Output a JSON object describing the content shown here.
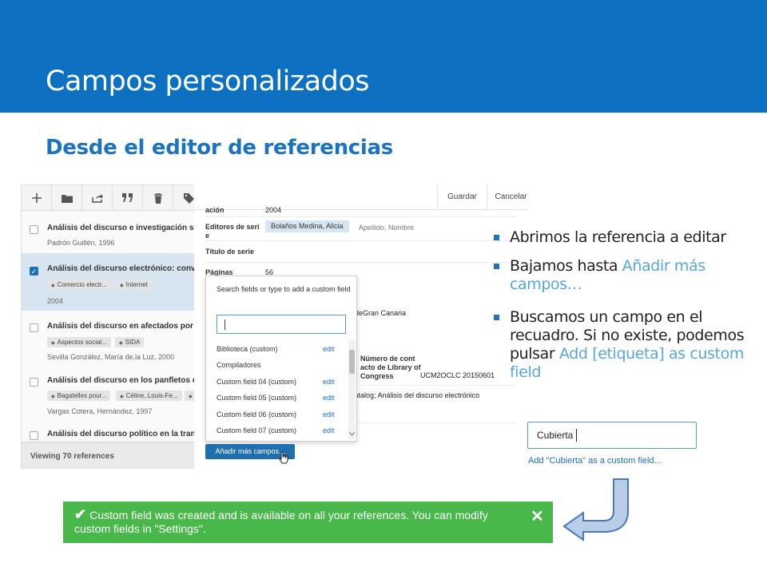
{
  "slide": {
    "title": "Campos personalizados",
    "subtitle": "Desde el editor de referencias",
    "banner_color": "#0e70c0",
    "accent_color": "#1b74c2"
  },
  "list_panel": {
    "toolbar_icons": [
      "plus-icon",
      "folder-icon",
      "share-icon",
      "quote-icon",
      "trash-icon",
      "tag-icon"
    ],
    "items": [
      {
        "title": "Análisis del discurso e investigación soc",
        "sub": "Padrón Guillén, 1996",
        "checked": false,
        "tags": []
      },
      {
        "title": "Análisis del discurso electrónico: conver",
        "sub": "2004",
        "checked": true,
        "tags": [
          "Comercio electr...",
          "Internet"
        ]
      },
      {
        "title": "Análisis del discurso en afectados por V",
        "sub": "Sevilla González, María de,la Luz, 2000",
        "checked": false,
        "tags": [
          "Aspectos social...",
          "SIDA"
        ]
      },
      {
        "title": "Análisis del discurso en los panfletos de",
        "sub": "Vargas Cotera, Hernández, 1997",
        "checked": false,
        "tags": [
          "Bagatelles pour...",
          "Céline, Louis-Fe..."
        ]
      },
      {
        "title": "Análisis del discurso político en la trans",
        "sub": "",
        "checked": false,
        "tags": []
      }
    ],
    "footer": "Viewing 70 references"
  },
  "editor": {
    "save_label": "Guardar",
    "cancel_label": "Cancelar",
    "year_label": "ación",
    "year_value": "2004",
    "editors_label": "Editores de seri e",
    "editor_chip": "Bolaños Medina, Alicia",
    "editor_hint": "Apellido, Nombre",
    "series_title_label": "Título de serie",
    "pages_label": "Páginas",
    "pages_value": "56",
    "partial_1": "s deGran Canaria",
    "partial_2": "ia",
    "lc_label": "Número de cont acto de Library of Congress",
    "lc_value": "UCM2OCLC 20150601",
    "catalog_value": "Catalog; Análisis del discurso electrónico",
    "dropdown": {
      "heading": "Search fields or type to add a custom field",
      "input_value": "",
      "items": [
        {
          "label": "Biblioteca (custom)",
          "edit": "edit"
        },
        {
          "label": "Compiladores",
          "edit": ""
        },
        {
          "label": "Custom field 04 (custom)",
          "edit": "edit"
        },
        {
          "label": "Custom field 05 (custom)",
          "edit": "edit"
        },
        {
          "label": "Custom field 06 (custom)",
          "edit": "edit"
        },
        {
          "label": "Custom field 07 (custom)",
          "edit": "edit"
        }
      ]
    },
    "add_button": "Añadir más campos..."
  },
  "bullets": [
    {
      "text": "Abrimos la referencia a editar",
      "link": ""
    },
    {
      "text": "Bajamos hasta ",
      "link": "Añadir más campos…"
    },
    {
      "text": "Buscamos un campo en el recuadro. Si no existe, podemos pulsar ",
      "link": "Add [etiqueta] as custom field"
    }
  ],
  "custom_field": {
    "input_value": "Cubierta",
    "add_link": "Add \"Cubierta\" as a custom field..."
  },
  "notice": {
    "text": "Custom field was created and is available on all your references. You can modify custom fields in \"Settings\".",
    "close": "✕",
    "color": "#49b84b"
  }
}
